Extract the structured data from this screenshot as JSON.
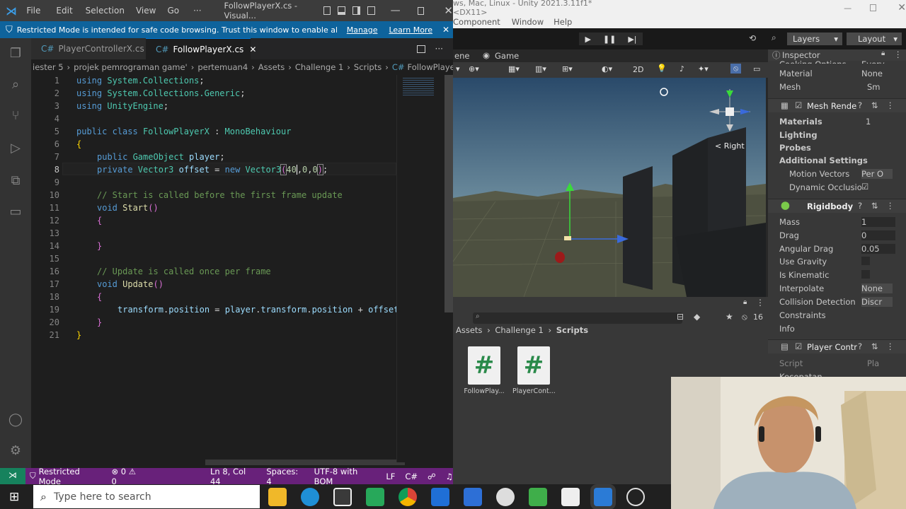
{
  "vscode": {
    "menu": [
      "File",
      "Edit",
      "Selection",
      "View",
      "Go",
      "···"
    ],
    "window_title": "FollowPlayerX.cs - Visual...",
    "restricted_banner": {
      "text": "Restricted Mode is intended for safe code browsing. Trust this window to enable all feat...",
      "manage": "Manage",
      "learn_more": "Learn More"
    },
    "tabs": [
      {
        "label": "PlayerControllerX.cs",
        "active": false
      },
      {
        "label": "FollowPlayerX.cs",
        "active": true
      }
    ],
    "breadcrumb": [
      "iester 5",
      "projek pemrograman game'",
      "pertemuan4",
      "Assets",
      "Challenge 1",
      "Scripts",
      "FollowPlayerX.cs"
    ],
    "line_numbers": [
      "1",
      "2",
      "3",
      "4",
      "5",
      "6",
      "7",
      "8",
      "9",
      "10",
      "11",
      "12",
      "13",
      "14",
      "15",
      "16",
      "17",
      "18",
      "19",
      "20",
      "21"
    ],
    "code": {
      "l1a": "using ",
      "l1b": "System.Collections",
      "l1c": ";",
      "l2a": "using ",
      "l2b": "System.Collections.Generic",
      "l2c": ";",
      "l3a": "using ",
      "l3b": "UnityEngine",
      "l3c": ";",
      "l5a": "public ",
      "l5b": "class ",
      "l5c": "FollowPlayerX",
      "l5d": " : ",
      "l5e": "MonoBehaviour",
      "l6": "{",
      "l7a": "public ",
      "l7b": "GameObject",
      "l7c": " player",
      "l7d": ";",
      "l8a": "private ",
      "l8b": "Vector3",
      "l8c": " offset",
      "l8d": " = ",
      "l8e": "new ",
      "l8f": "Vector3",
      "l8g": "(",
      "l8h": "40",
      "l8i": ",",
      "l8j": "0",
      "l8k": ",",
      "l8l": "0",
      "l8m": ")",
      "l8n": ";",
      "l10": "// Start is called before the first frame update",
      "l11a": "void ",
      "l11b": "Start",
      "l11c": "()",
      "l12": "{",
      "l14": "}",
      "l16": "// Update is called once per frame",
      "l17a": "void ",
      "l17b": "Update",
      "l17c": "()",
      "l18": "{",
      "l19a": "transform",
      "l19b": ".",
      "l19c": "position",
      "l19d": " = ",
      "l19e": "player",
      "l19f": ".",
      "l19g": "transform",
      "l19h": ".",
      "l19i": "position",
      "l19j": " + ",
      "l19k": "offset",
      "l20": "}",
      "l21": "}"
    },
    "status": {
      "mode": "Restricted Mode",
      "problems": "⊗ 0 ⚠ 0",
      "position": "Ln 8, Col 44",
      "spaces": "Spaces: 4",
      "encoding": "UTF-8 with BOM",
      "eol": "LF",
      "language": "C#"
    }
  },
  "unity": {
    "title": "ws, Mac, Linux - Unity 2021.3.11f1* <DX11>",
    "menu": [
      "Component",
      "Window",
      "Help"
    ],
    "layers": "Layers",
    "layout": "Layout",
    "tabs": {
      "scene": "ene",
      "game": "Game"
    },
    "scene_2d": "2D",
    "gizmo_label": "< Right",
    "project": {
      "breadcrumb": [
        "Assets",
        "Challenge 1",
        "Scripts"
      ],
      "count": "16",
      "files": [
        "FollowPlay...",
        "PlayerCont..."
      ]
    },
    "inspector": {
      "tab": "Inspector",
      "cut_top": "Cooking Options",
      "cut_top_val": "Every",
      "material": {
        "label": "Material",
        "value": "None"
      },
      "mesh": {
        "label": "Mesh",
        "value": "Sm"
      },
      "mesh_renderer": "Mesh Rende",
      "materials": {
        "label": "Materials",
        "value": "1"
      },
      "lighting": "Lighting",
      "probes": "Probes",
      "additional": "Additional Settings",
      "motion_vectors": {
        "label": "Motion Vectors",
        "value": "Per O"
      },
      "dynamic_occlusion": "Dynamic Occlusio",
      "rigidbody": "Rigidbody",
      "mass": {
        "label": "Mass",
        "value": "1"
      },
      "drag": {
        "label": "Drag",
        "value": "0"
      },
      "angular_drag": {
        "label": "Angular Drag",
        "value": "0.05"
      },
      "use_gravity": "Use Gravity",
      "is_kinematic": "Is Kinematic",
      "interpolate": {
        "label": "Interpolate",
        "value": "None"
      },
      "collision": {
        "label": "Collision Detection",
        "value": "Discr"
      },
      "constraints": "Constraints",
      "info": "Info",
      "player_controller": "Player Contr",
      "script": {
        "label": "Script",
        "value": "Pla"
      },
      "cut_bottom": "Kecepatan"
    }
  },
  "taskbar": {
    "search_placeholder": "Type here to search"
  }
}
